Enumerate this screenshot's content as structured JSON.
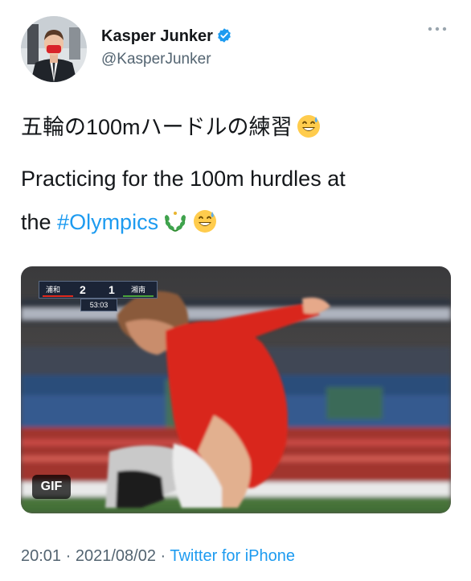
{
  "user": {
    "display_name": "Kasper Junker",
    "handle": "@KasperJunker",
    "verified": true
  },
  "tweet": {
    "text_jp": "五輪の100mハードルの練習",
    "text_en_line1": "Practicing for the 100m hurdles at",
    "text_en_line2_prefix": "the ",
    "hashtag": "#Olympics"
  },
  "media": {
    "type_badge": "GIF",
    "scoreboard": {
      "home_team": "浦和",
      "home_score": "2",
      "away_score": "1",
      "away_team": "湘南",
      "clock": "53:03"
    }
  },
  "footer": {
    "time": "20:01",
    "separator": " · ",
    "date": "2021/08/02",
    "source": "Twitter for iPhone"
  },
  "icons": {
    "verified": "verified-badge-icon",
    "more": "more-options-icon",
    "emoji": "grinning-sweat-emoji",
    "hashflag": "olympic-laurel-icon"
  },
  "colors": {
    "link": "#1d9bf0",
    "secondary_text": "#536471",
    "primary_text": "#14171a",
    "verified": "#1d9bf0"
  }
}
